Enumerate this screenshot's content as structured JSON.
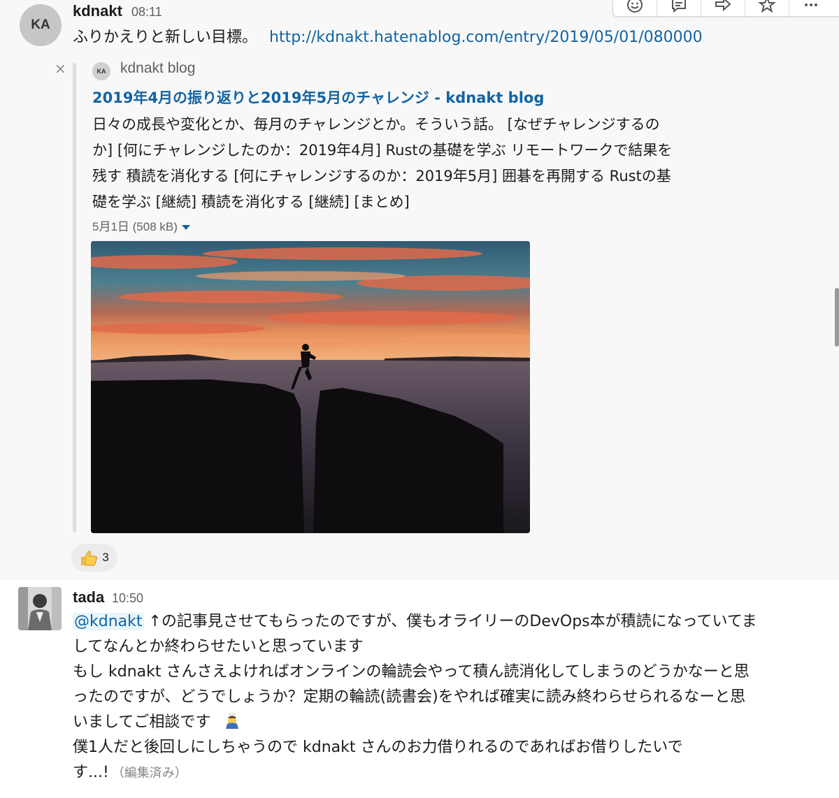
{
  "message1": {
    "avatar_initials": "KA",
    "sender": "kdnakt",
    "time": "08:11",
    "text": "ふりかえりと新しい目標。",
    "link": "http://kdnakt.hatenablog.com/entry/2019/05/01/080000"
  },
  "attachment": {
    "close_glyph": "×",
    "site_icon_initials": "KA",
    "site_name": "kdnakt blog",
    "title": "2019年4月の振り返りと2019年5月のチャレンジ - kdnakt blog",
    "description_lines": [
      "日々の成長や変化とか、毎月のチャレンジとか。そういう話。 [なぜチャレンジするの",
      "か] [何にチャレンジしたのか：2019年4月] Rustの基礎を学ぶ リモートワークで結果を",
      "残す 積読を消化する [何にチャレンジするのか：2019年5月] 囲碁を再開する Rustの基",
      "礎を学ぶ [継続] 積読を消化する [継続] [まとめ]"
    ],
    "meta": "5月1日 (508 kB)"
  },
  "reaction": {
    "icon": "thumbsup-emoji",
    "count": "3"
  },
  "message2": {
    "sender": "tada",
    "time": "10:50",
    "mention": "@kdnakt",
    "lines": [
      " ↑の記事見させてもらったのですが、僕もオライリーのDevOps本が積読になっていてま",
      "してなんとか終わらせたいと思っています",
      "もし kdnakt さんさえよければオンラインの輪読会やって積ん読消化してしまうのどうかなーと思",
      "ったのですが、どうでしょうか？定期の輪読(読書会)をやれば確実に読み終わらせられるなーと思",
      "いましてご相談です",
      "僕1人だと後回しにしちゃうので kdnakt さんのお力借りれるのであればお借りしたいで",
      "す...!"
    ],
    "edited": "（編集済み）"
  },
  "toolbar": [
    "emoji-reaction-icon",
    "reply-thread-icon",
    "share-icon",
    "star-icon",
    "more-icon"
  ]
}
